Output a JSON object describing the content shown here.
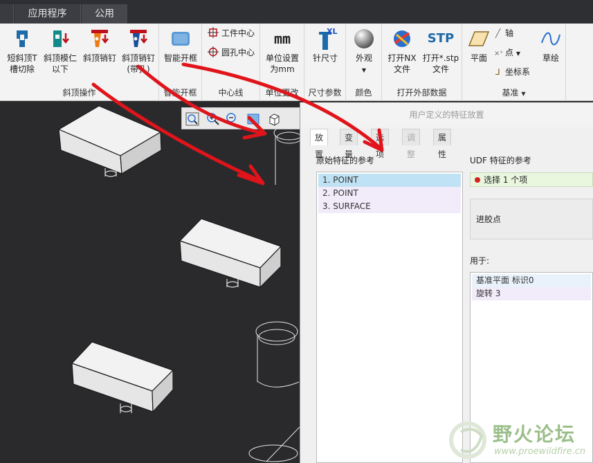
{
  "tabs": {
    "app": "应用程序",
    "public": "公用"
  },
  "ribbon": {
    "groups": {
      "slant": "斜顶操作",
      "smart": "智能开框",
      "center": "中心线",
      "unit": "单位更改",
      "dim": "尺寸参数",
      "color": "颜色",
      "open": "打开外部数据",
      "datum": "基准"
    },
    "buttons": {
      "short_slot_1": "短斜顶T",
      "short_slot_2": "槽切除",
      "core_1": "斜顶模仁",
      "core_2": "以下",
      "pin": "斜顶销钉",
      "pin_hole_1": "斜顶销钉",
      "pin_hole_2": "(带孔)",
      "smart_frame": "智能开框",
      "work_center": "工件中心",
      "hole_center": "圆孔中心",
      "unit_1": "单位设置",
      "unit_2": "为mm",
      "needle_size": "针尺寸",
      "appearance": "外观",
      "open_nx_1": "打开NX",
      "open_nx_2": "文件",
      "open_stp_1": "打开*.stp",
      "open_stp_2": "文件",
      "plane": "平面",
      "axis": "轴",
      "point": "点",
      "csys": "坐标系",
      "sketch": "草绘",
      "mm_icon_text": "mm",
      "xl_icon_text": "XL",
      "stp_icon_text": "STP"
    }
  },
  "dialog": {
    "title": "用户定义的特征放置",
    "tabs": [
      "放置",
      "变量",
      "选项",
      "调整",
      "属性"
    ],
    "orig_refs_label": "原始特征的参考",
    "orig_refs": [
      "1. POINT",
      "2. POINT",
      "3. SURFACE"
    ],
    "udf_refs_label": "UDF 特征的参考",
    "udf_ref_value": "选择 1 个项",
    "panel_text": "进胶点",
    "used_for_label": "用于:",
    "used_for": [
      "基准平面 标识0",
      "旋转 3"
    ]
  },
  "watermark": {
    "title": "野火论坛",
    "url": "www.proewildfire.cn"
  },
  "colors": {
    "annotation_arrow": "#e0141b",
    "selection": "#bfe3f5",
    "viewport": "#2a2a2d"
  }
}
